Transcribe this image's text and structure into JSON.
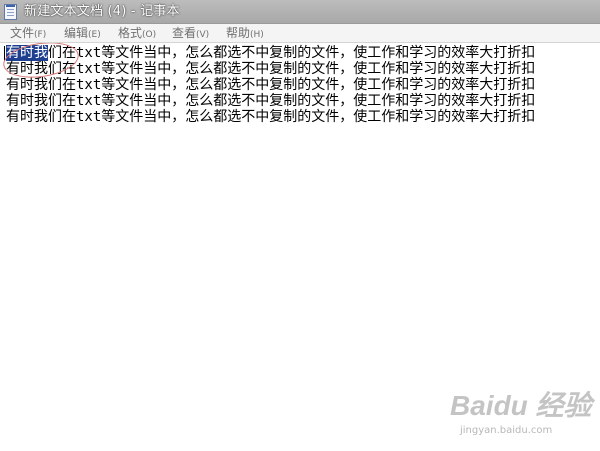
{
  "window": {
    "title": "新建文本文档 (4) - 记事本",
    "icon": "notepad-icon"
  },
  "menu": [
    {
      "label": "文件",
      "accel": "(F)"
    },
    {
      "label": "编辑",
      "accel": "(E)"
    },
    {
      "label": "格式",
      "accel": "(O)"
    },
    {
      "label": "查看",
      "accel": "(V)"
    },
    {
      "label": "帮助",
      "accel": "(H)"
    }
  ],
  "editor": {
    "selected_text": "有时我",
    "first_line_rest": "们在txt等文件当中，怎么都选不中复制的文件，使工作和学习的效率大打折扣",
    "lines": [
      "有时我们在txt等文件当中，怎么都选不中复制的文件，使工作和学习的效率大打折扣",
      "有时我们在txt等文件当中，怎么都选不中复制的文件，使工作和学习的效率大打折扣",
      "有时我们在txt等文件当中，怎么都选不中复制的文件，使工作和学习的效率大打折扣",
      "有时我们在txt等文件当中，怎么都选不中复制的文件，使工作和学习的效率大打折扣"
    ]
  },
  "watermark": {
    "logo_text": "Baidu 经验",
    "site": "jingyan.baidu.com"
  },
  "colors": {
    "titlebar": "#b4b4b4",
    "selection": "#1e3f8f",
    "annotation": "#d87878"
  }
}
